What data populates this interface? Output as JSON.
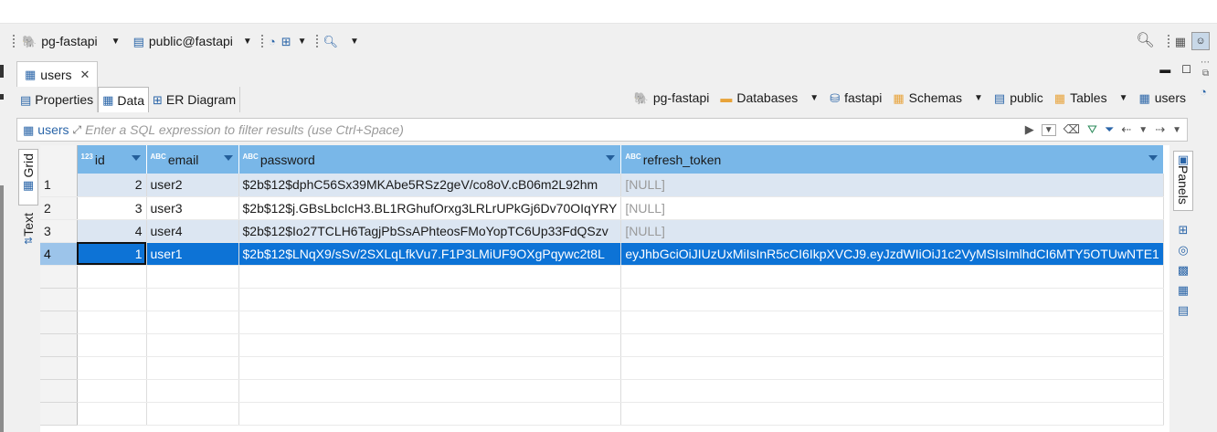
{
  "toolbar": {
    "connection": "pg-fastapi",
    "schema": "public@fastapi"
  },
  "editor": {
    "tab_title": "users",
    "subtabs": [
      "Properties",
      "Data",
      "ER Diagram"
    ],
    "breadcrumbs": [
      "pg-fastapi",
      "Databases",
      "fastapi",
      "Schemas",
      "public",
      "Tables",
      "users"
    ]
  },
  "filter": {
    "table_label": "users",
    "placeholder": "Enter a SQL expression to filter results (use Ctrl+Space)"
  },
  "side_tabs": {
    "grid": "Grid",
    "text": "Text"
  },
  "panels_label": "Panels",
  "type_badges": {
    "number": "123",
    "text": "ABC"
  },
  "grid": {
    "columns": [
      "id",
      "email",
      "password",
      "refresh_token"
    ],
    "rows": [
      {
        "num": "1",
        "id": "2",
        "email": "user2",
        "password": "$2b$12$dphC56Sx39MKAbe5RSz2geV/co8oV.cB06m2L92hm",
        "refresh_token": "[NULL]"
      },
      {
        "num": "2",
        "id": "3",
        "email": "user3",
        "password": "$2b$12$j.GBsLbcIcH3.BL1RGhufOrxg3LRLrUPkGj6Dv70OIqYRY",
        "refresh_token": "[NULL]"
      },
      {
        "num": "3",
        "id": "4",
        "email": "user4",
        "password": "$2b$12$Io27TCLH6TagjPbSsAPhteosFMoYopTC6Up33FdQSzv",
        "refresh_token": "[NULL]"
      },
      {
        "num": "4",
        "id": "1",
        "email": "user1",
        "password": "$2b$12$LNqX9/sSv/2SXLqLfkVu7.F1P3LMiUF9OXgPqywc2t8L",
        "refresh_token": "eyJhbGciOiJIUzUxMiIsInR5cCI6IkpXVCJ9.eyJzdWIiOiJ1c2VyMSIsImlhdCI6MTY5OTUwNTE1"
      }
    ]
  },
  "colors": {
    "header": "#79b7e8",
    "selected_row": "#0d73d6",
    "alt_row": "#dce6f2"
  }
}
